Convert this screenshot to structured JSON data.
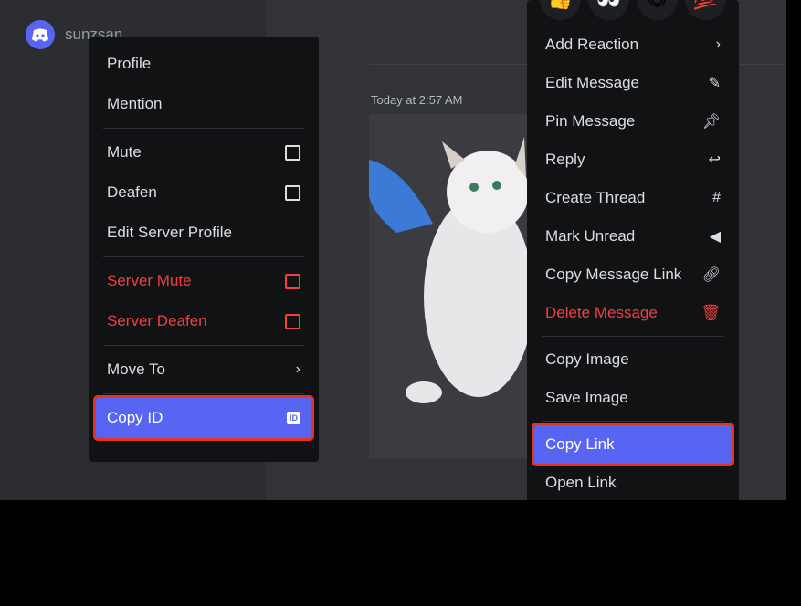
{
  "member": {
    "name": "sunzsan"
  },
  "message": {
    "timestamp": "Today at 2:57 AM"
  },
  "user_menu": {
    "items": [
      {
        "label": "Profile"
      },
      {
        "label": "Mention"
      },
      {
        "label": "Mute"
      },
      {
        "label": "Deafen"
      },
      {
        "label": "Edit Server Profile"
      },
      {
        "label": "Server Mute"
      },
      {
        "label": "Server Deafen"
      },
      {
        "label": "Move To"
      },
      {
        "label": "Copy ID",
        "badge": "ID"
      }
    ]
  },
  "message_menu": {
    "reactions": [
      "👍",
      "👀",
      "😆",
      "💯"
    ],
    "items": [
      {
        "label": "Add Reaction"
      },
      {
        "label": "Edit Message"
      },
      {
        "label": "Pin Message"
      },
      {
        "label": "Reply"
      },
      {
        "label": "Create Thread"
      },
      {
        "label": "Mark Unread"
      },
      {
        "label": "Copy Message Link"
      },
      {
        "label": "Delete Message"
      },
      {
        "label": "Copy Image"
      },
      {
        "label": "Save Image"
      },
      {
        "label": "Copy Link"
      },
      {
        "label": "Open Link"
      }
    ]
  },
  "colors": {
    "accent": "#5865f2",
    "danger": "#f23f43",
    "highlight_border": "#e8331c"
  }
}
